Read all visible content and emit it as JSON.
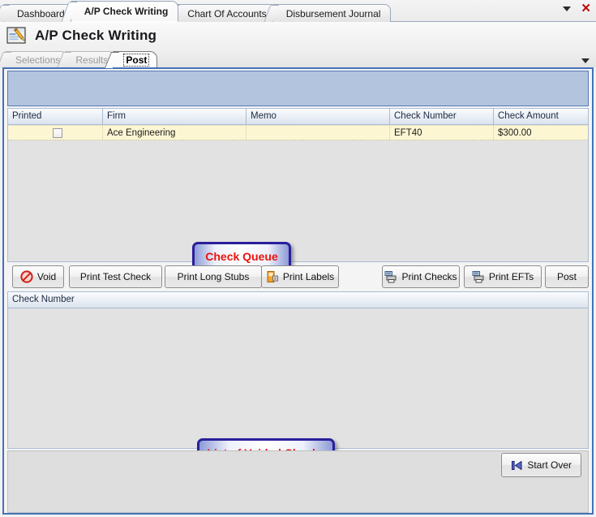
{
  "window": {
    "tabs": [
      {
        "label": "Dashboard",
        "active": false
      },
      {
        "label": "A/P Check Writing",
        "active": true
      },
      {
        "label": "Chart Of Accounts",
        "active": false
      },
      {
        "label": "Disbursement Journal",
        "active": false
      }
    ],
    "dropdown_icon": "caret-down-icon",
    "close_icon": "close-icon"
  },
  "page": {
    "title": "A/P Check Writing",
    "title_icon": "check-writing-icon"
  },
  "inner_tabs": {
    "items": [
      {
        "label": "Selections",
        "active": false,
        "enabled": false
      },
      {
        "label": "Results",
        "active": false,
        "enabled": false
      },
      {
        "label": "Post",
        "active": true,
        "enabled": true
      }
    ],
    "overflow_icon": "caret-down-icon"
  },
  "check_queue_grid": {
    "columns": [
      "Printed",
      "Firm",
      "Memo",
      "Check Number",
      "Check Amount"
    ],
    "rows": [
      {
        "printed": false,
        "firm": "Ace Engineering",
        "memo": "",
        "check_number": "EFT40",
        "check_amount": "$300.00"
      }
    ]
  },
  "callouts": {
    "check_queue": "Check Queue",
    "voided_checks": "List of Voided Checks"
  },
  "toolbar": {
    "void": {
      "label": "Void",
      "icon": "no-entry-icon"
    },
    "print_test_check": {
      "label": "Print Test Check",
      "icon": ""
    },
    "print_long_stubs": {
      "label": "Print Long Stubs",
      "icon": ""
    },
    "print_labels": {
      "label": "Print Labels",
      "icon": "label-tag-icon"
    },
    "print_checks": {
      "label": "Print Checks",
      "icon": "printer-icon"
    },
    "print_efts": {
      "label": "Print EFTs",
      "icon": "printer-icon"
    },
    "post": {
      "label": "Post",
      "icon": ""
    }
  },
  "voided_grid": {
    "columns": [
      "Check Number"
    ],
    "rows": []
  },
  "footer": {
    "start_over": {
      "label": "Start Over",
      "icon": "skip-to-start-icon"
    }
  },
  "colors": {
    "accent_blue": "#4472b8",
    "banner_blue": "#b3c4de",
    "callout_border": "#2a1f9c",
    "callout_text": "#e8140c",
    "row_highlight": "#fdf6d3",
    "close_red": "#bb0b0b"
  }
}
